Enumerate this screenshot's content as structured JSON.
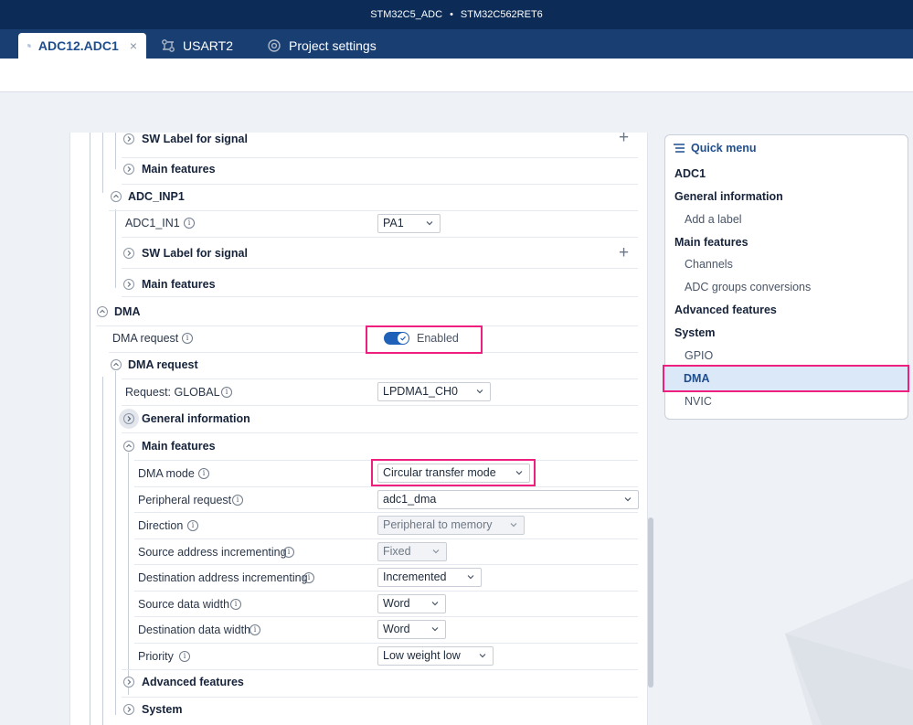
{
  "window": {
    "project": "STM32C5_ADC",
    "separator": "•",
    "device": "STM32C562RET6"
  },
  "tabs": [
    {
      "label": "ADC12.ADC1",
      "active": true,
      "icon": "peripheral-icon",
      "close": "×"
    },
    {
      "label": "USART2",
      "active": false,
      "icon": "peripheral-icon"
    },
    {
      "label": "Project settings",
      "active": false,
      "icon": "gear-icon"
    }
  ],
  "config": {
    "adc_inp1_prev": {
      "sw_label": "SW Label for signal",
      "main_features": "Main features"
    },
    "adc_inp1": {
      "title": "ADC_INP1",
      "pin_label": "ADC1_IN1",
      "pin_value": "PA1",
      "sw_label": "SW Label for signal",
      "main_features": "Main features"
    },
    "dma": {
      "title": "DMA",
      "request_label": "DMA request",
      "request_state": "Enabled",
      "request_enabled": true,
      "sub_title": "DMA request",
      "global_label": "Request: GLOBAL",
      "global_value": "LPDMA1_CH0",
      "general_information": "General information",
      "main_features": "Main features",
      "fields": [
        {
          "label": "DMA mode",
          "value": "Circular transfer mode",
          "disabled": false
        },
        {
          "label": "Peripheral request",
          "value": "adc1_dma",
          "disabled": false
        },
        {
          "label": "Direction",
          "value": "Peripheral to memory",
          "disabled": true
        },
        {
          "label": "Source address incrementing",
          "value": "Fixed",
          "disabled": true
        },
        {
          "label": "Destination address incrementing",
          "value": "Incremented",
          "disabled": false
        },
        {
          "label": "Source data width",
          "value": "Word",
          "disabled": false
        },
        {
          "label": "Destination data width",
          "value": "Word",
          "disabled": false
        },
        {
          "label": "Priority",
          "value": "Low weight low",
          "disabled": false
        }
      ],
      "advanced_features": "Advanced features",
      "system": "System"
    },
    "plus_icon": "+",
    "info_icon": "i"
  },
  "quick_menu": {
    "title": "Quick menu",
    "items": [
      {
        "label": "ADC1",
        "level": 0
      },
      {
        "label": "General information",
        "level": 0
      },
      {
        "label": "Add a label",
        "level": 1
      },
      {
        "label": "Main features",
        "level": 0
      },
      {
        "label": "Channels",
        "level": 1
      },
      {
        "label": "ADC groups conversions",
        "level": 1
      },
      {
        "label": "Advanced features",
        "level": 0
      },
      {
        "label": "System",
        "level": 0
      },
      {
        "label": "GPIO",
        "level": 1
      },
      {
        "label": "DMA",
        "level": 1,
        "selected": true
      },
      {
        "label": "NVIC",
        "level": 1
      }
    ]
  },
  "colors": {
    "title_bar": "#0c2c57",
    "tab_bar": "#193f72",
    "accent": "#1f61b8",
    "highlight": "#ee1f7f"
  }
}
